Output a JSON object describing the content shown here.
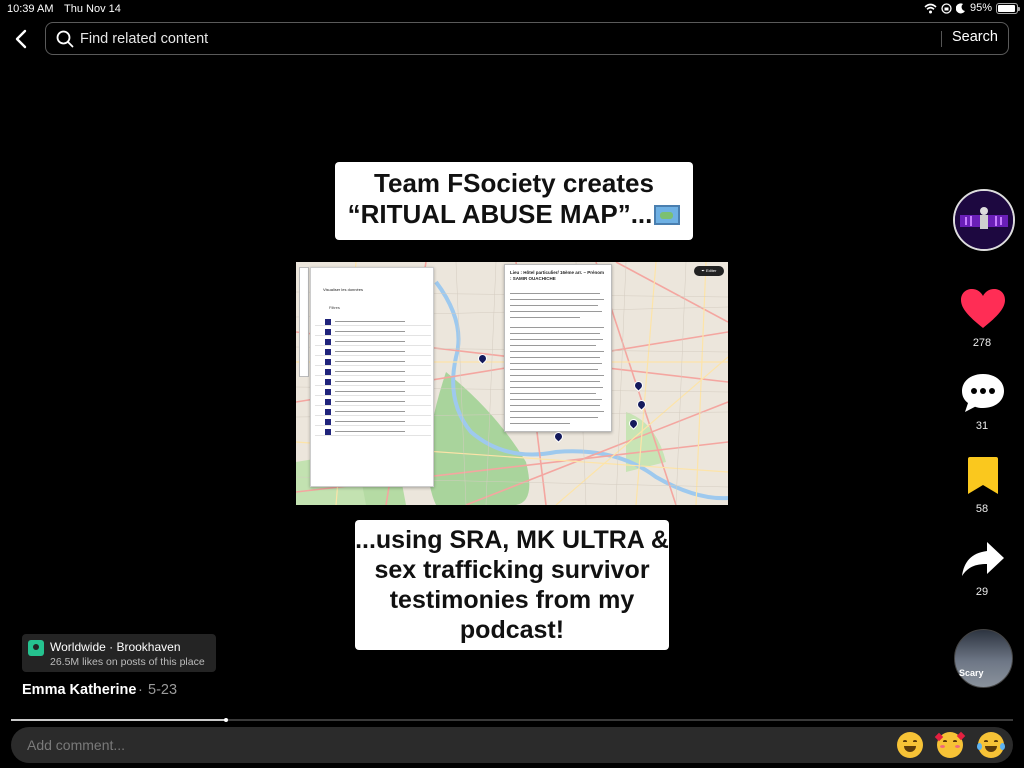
{
  "status_bar": {
    "time": "10:39 AM",
    "date": "Thu Nov 14",
    "battery_percent": "95%",
    "battery_level": 0.95
  },
  "search": {
    "placeholder": "Find related content",
    "button_label": "Search"
  },
  "post": {
    "caption_top_line1": "Team FSociety creates",
    "caption_top_line2": "“RITUAL ABUSE MAP”...",
    "caption_bottom_lines": [
      "...using SRA, MK ULTRA &",
      "sex trafficking survivor",
      "testimonies from my",
      "podcast!"
    ]
  },
  "map_screenshot": {
    "panel_title": "Visualiser les données",
    "panel_filter": "Filtres",
    "popup_title": "Lieu : Hôtel particulier/ 16ème arr. – Prénom : SAMIR OUACHICHE",
    "editor_label": "✒ Editer"
  },
  "actions": {
    "likes": "278",
    "comments": "31",
    "saves": "58",
    "shares": "29"
  },
  "music": {
    "label": "Scary"
  },
  "location": {
    "title": "Worldwide · Brookhaven",
    "subtitle": "26.5M likes on posts of this place"
  },
  "author": {
    "name": "Emma Katherine",
    "separator": "·",
    "date": "5-23"
  },
  "playback": {
    "progress": 0.215
  },
  "comment": {
    "placeholder": "Add comment..."
  },
  "icons": {
    "back": "chevron-left-icon",
    "search": "search-icon",
    "like": "heart-icon",
    "comment": "comment-bubble-icon",
    "save": "bookmark-icon",
    "share": "share-arrow-icon",
    "location": "location-pin-icon",
    "map_emoji": "world-map-emoji"
  },
  "colors": {
    "like_red": "#ff2d55",
    "save_yellow": "#fac81e",
    "location_green": "#25c28f",
    "background": "#000000"
  }
}
